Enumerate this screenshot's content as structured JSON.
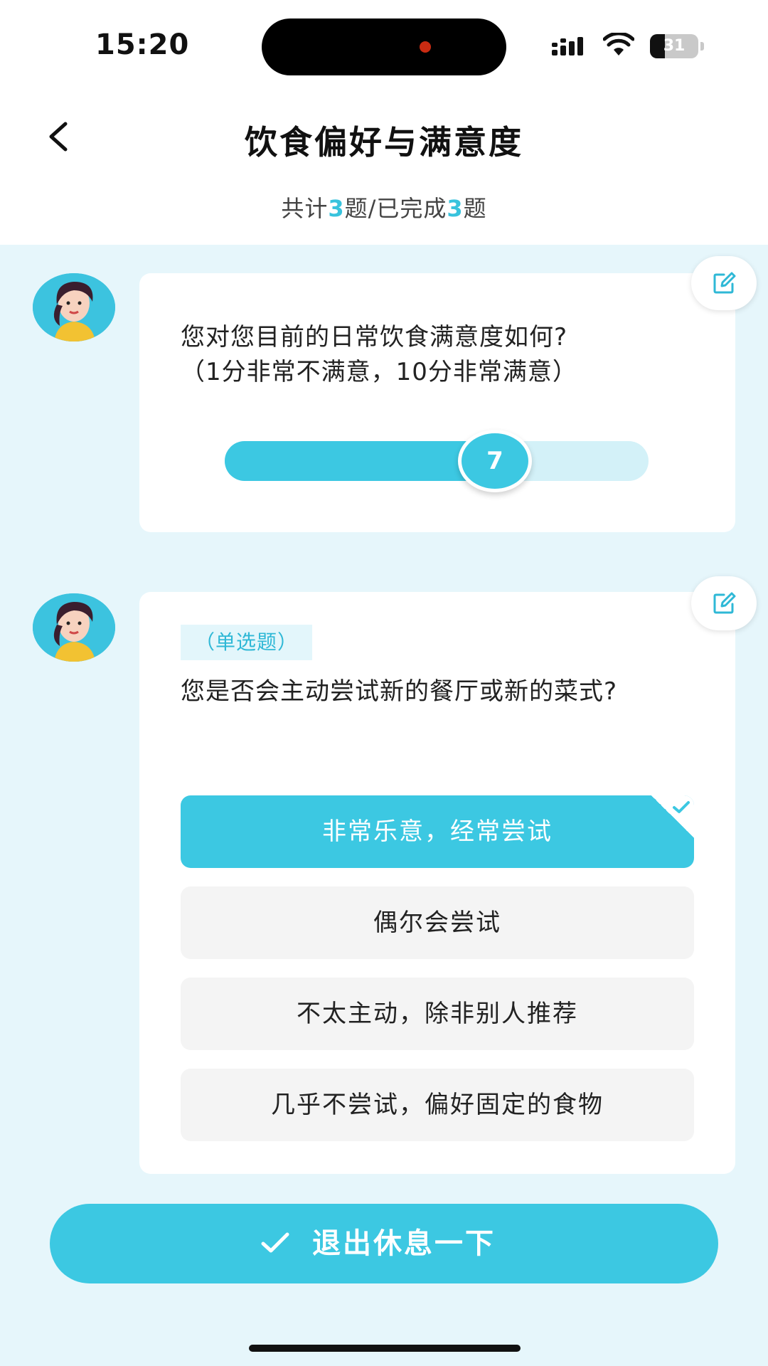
{
  "status_bar": {
    "time": "15:20",
    "battery_level": "31",
    "battery_fraction": 0.31
  },
  "header": {
    "title": "饮食偏好与满意度",
    "progress": {
      "prefix": "共计",
      "total": "3",
      "middle": "题/已完成",
      "completed": "3",
      "suffix": "题"
    }
  },
  "questions": [
    {
      "text_line1": "您对您目前的日常饮食满意度如何?",
      "text_line2": "（1分非常不满意，10分非常满意）",
      "slider": {
        "min": 1,
        "max": 10,
        "value": 7,
        "value_label": "7"
      }
    },
    {
      "type_tag": "（单选题）",
      "text": "您是否会主动尝试新的餐厅或新的菜式?",
      "options": [
        {
          "label": "非常乐意，经常尝试",
          "selected": true
        },
        {
          "label": "偶尔会尝试",
          "selected": false
        },
        {
          "label": "不太主动，除非别人推荐",
          "selected": false
        },
        {
          "label": "几乎不尝试，偏好固定的食物",
          "selected": false
        }
      ]
    }
  ],
  "footer": {
    "exit_label": "退出休息一下"
  },
  "colors": {
    "accent": "#3cc8e2",
    "background": "#e6f6fb",
    "track": "#d3f1f8"
  }
}
